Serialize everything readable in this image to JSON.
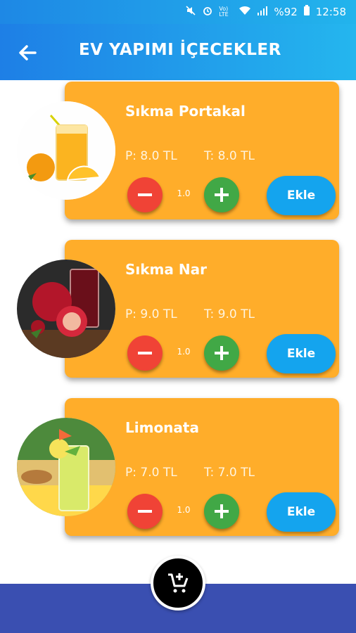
{
  "status_bar": {
    "battery": "%92",
    "time": "12:58",
    "network_label": "Vo) LTE"
  },
  "app_bar": {
    "title": "EV YAPIMI İÇECEKLER"
  },
  "products": [
    {
      "name": "Sıkma Portakal",
      "unit_price": "P: 8.0 TL",
      "total_price": "T: 8.0 TL",
      "quantity": "1.0",
      "add_label": "Ekle",
      "image": "orange-juice-icon"
    },
    {
      "name": "Sıkma Nar",
      "unit_price": "P: 9.0 TL",
      "total_price": "T: 9.0 TL",
      "quantity": "1.0",
      "add_label": "Ekle",
      "image": "pomegranate-juice-icon"
    },
    {
      "name": "Limonata",
      "unit_price": "P: 7.0 TL",
      "total_price": "T: 7.0 TL",
      "quantity": "1.0",
      "add_label": "Ekle",
      "image": "lemonade-icon"
    }
  ],
  "colors": {
    "app_bar": "#1e88e5",
    "card": "#ffad2a",
    "minus": "#f04336",
    "plus": "#41a846",
    "add": "#14a4ee",
    "bottom_bar": "#3a4fb1"
  }
}
